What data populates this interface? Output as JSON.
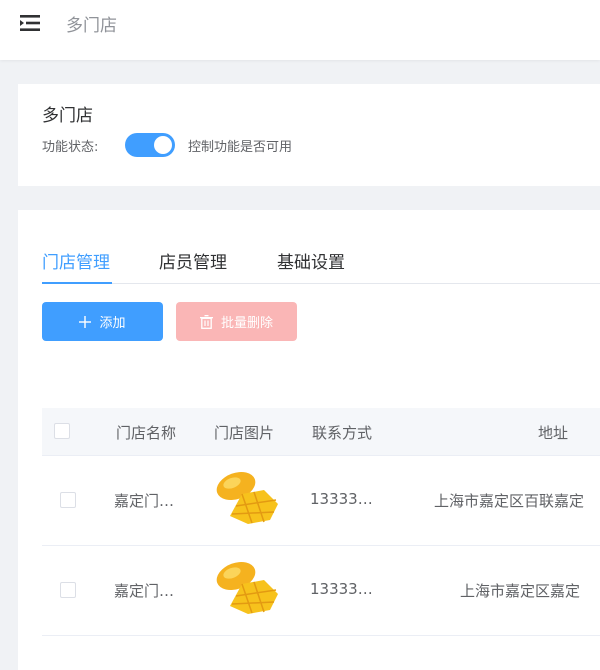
{
  "header": {
    "breadcrumb": "多门店"
  },
  "feature": {
    "title": "多门店",
    "status_label": "功能状态:",
    "switch_on": true,
    "switch_description": "控制功能是否可用"
  },
  "tabs": [
    {
      "label": "门店管理",
      "active": true
    },
    {
      "label": "店员管理",
      "active": false
    },
    {
      "label": "基础设置",
      "active": false
    }
  ],
  "toolbar": {
    "add_label": "添加",
    "batch_delete_label": "批量删除"
  },
  "table": {
    "columns": [
      "门店名称",
      "门店图片",
      "联系方式",
      "地址"
    ],
    "rows": [
      {
        "name": "嘉定门…",
        "phone": "13333…",
        "address": "上海市嘉定区百联嘉定"
      },
      {
        "name": "嘉定门…",
        "phone": "13333…",
        "address": "上海市嘉定区嘉定"
      }
    ]
  },
  "colors": {
    "primary": "#409eff",
    "danger_disabled": "#fab6b6",
    "background": "#f0f2f5"
  }
}
